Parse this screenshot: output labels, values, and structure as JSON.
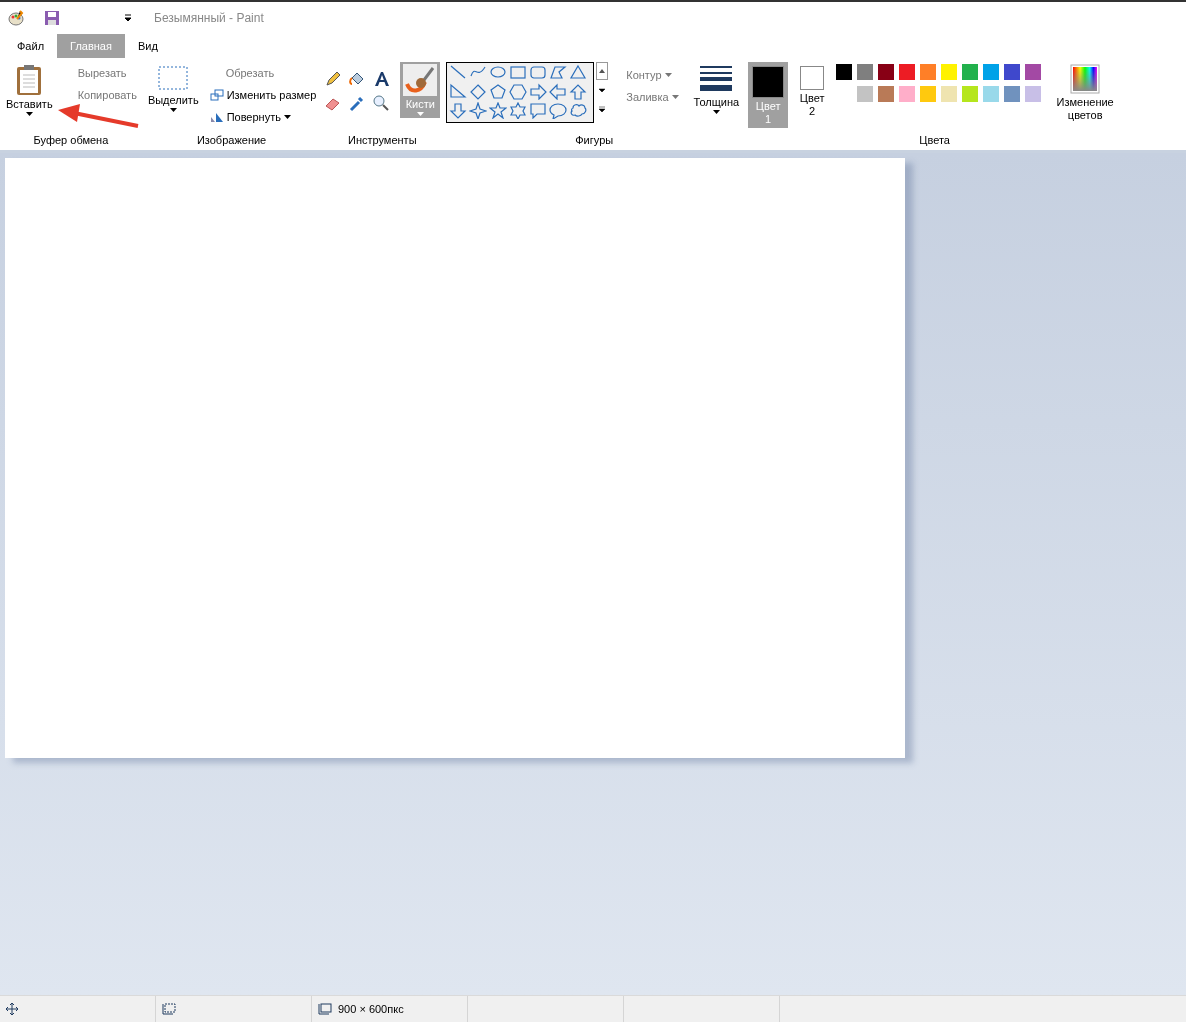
{
  "window": {
    "title": "Безымянный - Paint"
  },
  "tabs": [
    {
      "label": "Файл",
      "selected": false
    },
    {
      "label": "Главная",
      "selected": true
    },
    {
      "label": "Вид",
      "selected": false
    }
  ],
  "clipboard": {
    "paste": "Вставить",
    "cut": "Вырезать",
    "copy": "Копировать",
    "group": "Буфер обмена"
  },
  "image": {
    "select": "Выделить",
    "crop": "Обрезать",
    "resize": "Изменить размер",
    "rotate": "Повернуть",
    "group": "Изображение"
  },
  "tools": {
    "group": "Инструменты",
    "brushes": "Кисти"
  },
  "shapes": {
    "group": "Фигуры",
    "outline": "Контур",
    "fill": "Заливка",
    "size": "Толщина"
  },
  "colors": {
    "group": "Цвета",
    "edit": "Изменение цветов",
    "active": [
      {
        "label": "Цвет",
        "number": "1",
        "color": "#000000",
        "selected": true
      },
      {
        "label": "Цвет",
        "number": "2",
        "color": "#ffffff",
        "selected": false
      }
    ],
    "palette": [
      {
        "color": "#000000"
      },
      {
        "color": "#7f7f7f"
      },
      {
        "color": "#880015"
      },
      {
        "color": "#ed1c24"
      },
      {
        "color": "#ff7f27"
      },
      {
        "color": "#fff200"
      },
      {
        "color": "#22b14c"
      },
      {
        "color": "#00a2e8"
      },
      {
        "color": "#3f48cc"
      },
      {
        "color": "#a349a4"
      },
      {
        "color": "#c3c3c3"
      },
      {
        "color": "#b97a57"
      },
      {
        "color": "#ffaec9"
      },
      {
        "color": "#ffc90e"
      },
      {
        "color": "#efe4b0"
      },
      {
        "color": "#b5e61d"
      },
      {
        "color": "#99d9ea"
      },
      {
        "color": "#7092be"
      },
      {
        "color": "#c8bfe7"
      }
    ]
  },
  "status_bar": {
    "size": "900 × 600пкс"
  }
}
